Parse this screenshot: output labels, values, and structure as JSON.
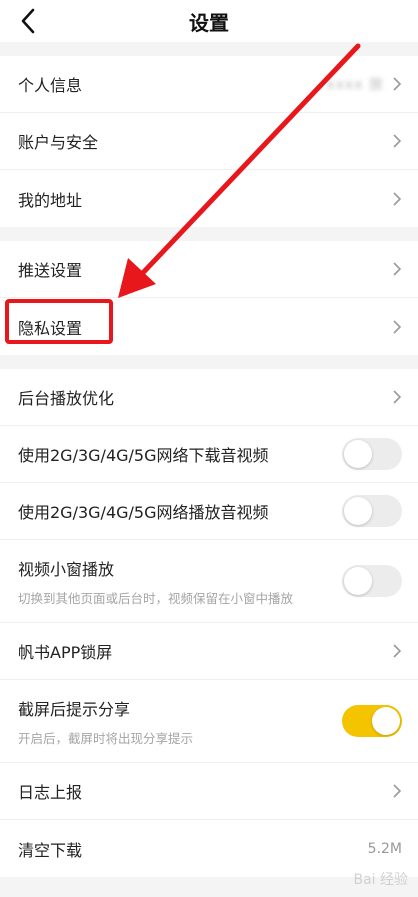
{
  "header": {
    "title": "设置",
    "back_icon": "chevron-left-icon"
  },
  "groups": [
    {
      "items": [
        {
          "id": "profile",
          "label": "个人信息",
          "blurred_value": "xxxx 放"
        },
        {
          "id": "account",
          "label": "账户与安全"
        },
        {
          "id": "address",
          "label": "我的地址"
        }
      ]
    },
    {
      "items": [
        {
          "id": "push",
          "label": "推送设置"
        },
        {
          "id": "privacy",
          "label": "隐私设置"
        }
      ]
    },
    {
      "items": [
        {
          "id": "bg-play",
          "label": "后台播放优化"
        },
        {
          "id": "mobile-download",
          "label": "使用2G/3G/4G/5G网络下载音视频",
          "toggle": false
        },
        {
          "id": "mobile-play",
          "label": "使用2G/3G/4G/5G网络播放音视频",
          "toggle": false
        },
        {
          "id": "pip",
          "label": "视频小窗播放",
          "sub": "切换到其他页面或后台时，视频保留在小窗中播放",
          "toggle": false
        },
        {
          "id": "app-lock",
          "label": "帆书APP锁屏"
        },
        {
          "id": "screenshot-share",
          "label": "截屏后提示分享",
          "sub": "开启后，截屏时将出现分享提示",
          "toggle": true
        },
        {
          "id": "log-report",
          "label": "日志上报"
        },
        {
          "id": "clear-download",
          "label": "清空下载",
          "value": "5.2M"
        }
      ]
    }
  ],
  "watermark": "Bai 经验",
  "colors": {
    "toggle_on": "#f5c400",
    "annotation_red": "#e8171c"
  }
}
